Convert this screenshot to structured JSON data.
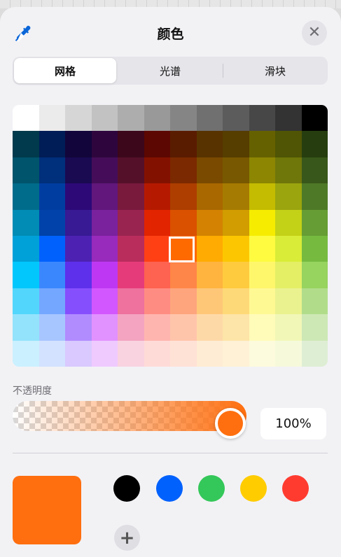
{
  "header": {
    "title": "颜色",
    "close_label": "✕",
    "eyedropper_icon": "eyedropper-icon"
  },
  "tabs": [
    {
      "label": "网格",
      "active": true
    },
    {
      "label": "光谱",
      "active": false
    },
    {
      "label": "滑块",
      "active": false
    }
  ],
  "grid": {
    "selected": {
      "row": 5,
      "col": 6
    },
    "rows": [
      [
        "#ffffff",
        "#ebebeb",
        "#d6d6d6",
        "#c2c2c2",
        "#adadad",
        "#999999",
        "#858585",
        "#707070",
        "#5c5c5c",
        "#474747",
        "#333333",
        "#000000"
      ],
      [
        "#003a4c",
        "#001d57",
        "#12053b",
        "#2e063d",
        "#3c071b",
        "#5c0701",
        "#5a1c00",
        "#583300",
        "#563d00",
        "#666100",
        "#4f5504",
        "#263e0f"
      ],
      [
        "#00546c",
        "#002f7b",
        "#1a0a52",
        "#450d59",
        "#551029",
        "#831100",
        "#7b2900",
        "#7a4a00",
        "#785800",
        "#8c8602",
        "#6f760a",
        "#38571a"
      ],
      [
        "#006c8c",
        "#003da1",
        "#2c0977",
        "#61177c",
        "#791a3d",
        "#b51a00",
        "#ad3e00",
        "#a96800",
        "#a67b01",
        "#c4bc00",
        "#9ba50e",
        "#4e7a27"
      ],
      [
        "#008cb4",
        "#0042a9",
        "#371a94",
        "#7a219e",
        "#99244f",
        "#e22400",
        "#da5100",
        "#d38301",
        "#d19d01",
        "#f5ec00",
        "#c3d117",
        "#669d34"
      ],
      [
        "#00a1d8",
        "#0061fd",
        "#4d22b2",
        "#982abc",
        "#b92d5d",
        "#ff4015",
        "#ff6a00",
        "#ffab01",
        "#fcc700",
        "#fefb41",
        "#d9ec37",
        "#76bb40"
      ],
      [
        "#01c7fc",
        "#3a87fd",
        "#5e30eb",
        "#be38f3",
        "#e63b7a",
        "#fe6250",
        "#fe8648",
        "#feb43f",
        "#fecb3e",
        "#fff76b",
        "#e4ef65",
        "#96d35f"
      ],
      [
        "#52d6fc",
        "#74a7ff",
        "#864ffd",
        "#d357fe",
        "#ee719e",
        "#ff8c82",
        "#fea57d",
        "#fec777",
        "#fed977",
        "#fff994",
        "#eaf28f",
        "#b1dd8b"
      ],
      [
        "#93e3fc",
        "#a7c6ff",
        "#b18cfe",
        "#e292fe",
        "#f4a4c0",
        "#ffb5af",
        "#ffc5ab",
        "#fed9a8",
        "#fde4a8",
        "#fffbb9",
        "#f1f7b7",
        "#cde8b5"
      ],
      [
        "#cbf0ff",
        "#d3e2ff",
        "#d9c9fe",
        "#efcaff",
        "#f9d3e0",
        "#ffdbd8",
        "#ffe2d6",
        "#feecd4",
        "#fef1d5",
        "#fdfbdd",
        "#f6fadb",
        "#deeed4"
      ]
    ]
  },
  "opacity": {
    "label": "不透明度",
    "value_text": "100%",
    "value": 1.0,
    "color": "#ff6f0f"
  },
  "current_color": "#ff6f0f",
  "saved_colors": [
    {
      "name": "black",
      "color": "#000000"
    },
    {
      "name": "blue",
      "color": "#0061fd"
    },
    {
      "name": "green",
      "color": "#34c759"
    },
    {
      "name": "yellow",
      "color": "#ffcc00"
    },
    {
      "name": "red",
      "color": "#ff3b30"
    }
  ],
  "add_label": "+"
}
